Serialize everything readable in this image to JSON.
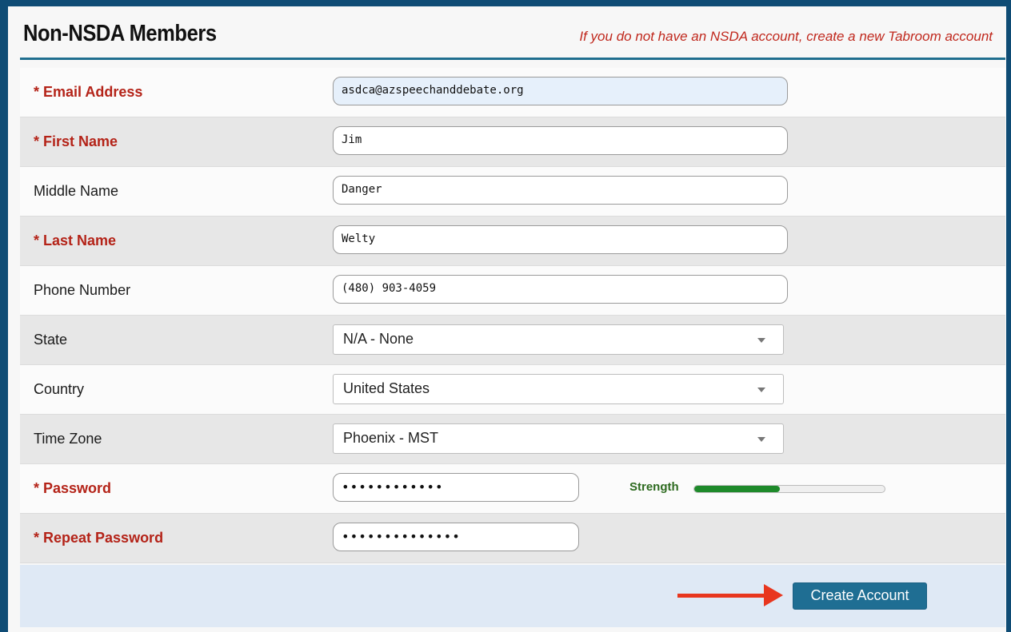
{
  "header": {
    "title": "Non-NSDA Members",
    "subtitle": "If you do not have an NSDA account, create a new Tabroom account"
  },
  "fields": {
    "email": {
      "label": "* Email Address",
      "value": "asdca@azspeechanddebate.org"
    },
    "first_name": {
      "label": "* First Name",
      "value": "Jim"
    },
    "middle_name": {
      "label": "Middle Name",
      "value": "Danger"
    },
    "last_name": {
      "label": "* Last Name",
      "value": "Welty"
    },
    "phone": {
      "label": "Phone Number",
      "value": "(480) 903-4059"
    },
    "state": {
      "label": "State",
      "value": "N/A - None"
    },
    "country": {
      "label": "Country",
      "value": "United States"
    },
    "timezone": {
      "label": "Time Zone",
      "value": "Phoenix - MST"
    },
    "password": {
      "label": "* Password",
      "value": "••••••••••••",
      "strength_label": "Strength",
      "strength_fraction": 0.45
    },
    "repeat_password": {
      "label": "* Repeat Password",
      "value": "••••••••••••••"
    }
  },
  "footer": {
    "create_label": "Create Account"
  },
  "colors": {
    "required": "#b42318",
    "accent": "#1f6e93",
    "arrow": "#e8361e",
    "strength": "#1e8a2a"
  }
}
